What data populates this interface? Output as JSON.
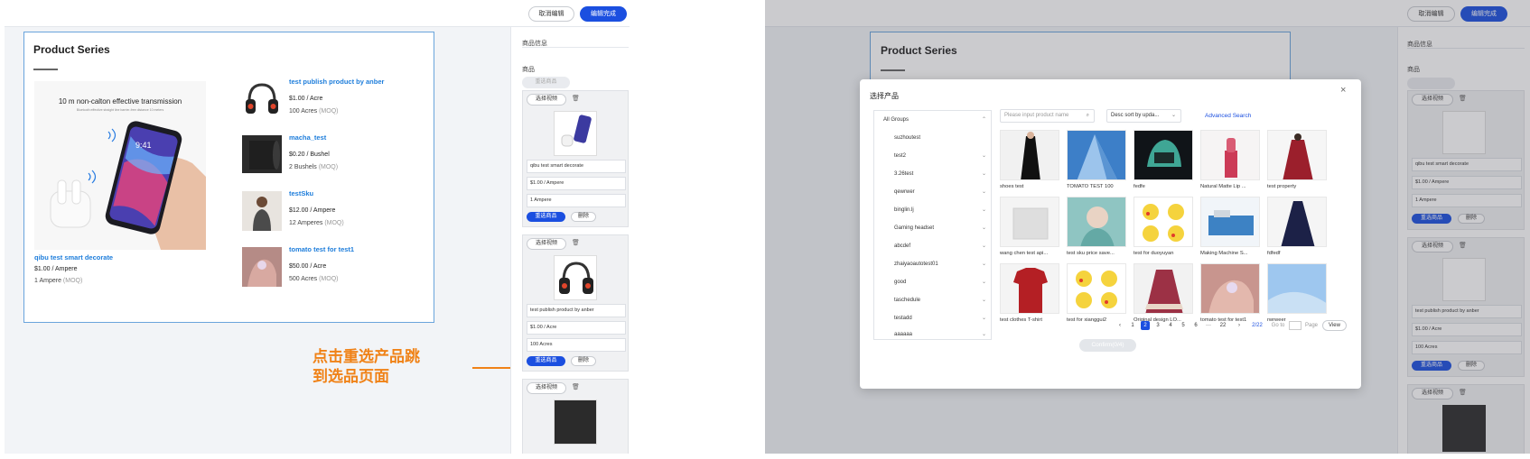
{
  "left_screen": {
    "topbar": {
      "cancel_label": "取消编辑",
      "done_label": "编辑完成"
    },
    "series": {
      "title": "Product Series",
      "banner_headline": "10 m non-calton effective transmission",
      "banner_subline": "Bluetooth effective straight line barrier-free distance 10 meters",
      "phone_time": "9:41",
      "main_product": {
        "name": "qibu test smart decorate",
        "price": "$1.00 / Ampere",
        "moq_value": "1 Ampere",
        "moq_tag": "(MOQ)"
      },
      "products": [
        {
          "name": "test publish product by anber",
          "price": "$1.00 / Acre",
          "moq_value": "100 Acres",
          "moq_tag": "(MOQ)",
          "thumb": "headset"
        },
        {
          "name": "macha_test",
          "price": "$0.20 / Bushel",
          "moq_value": "2 Bushels",
          "moq_tag": "(MOQ)",
          "thumb": "roll"
        },
        {
          "name": "testSku",
          "price": "$12.00 / Ampere",
          "moq_value": "12 Amperes",
          "moq_tag": "(MOQ)",
          "thumb": "person"
        },
        {
          "name": "tomato test for test1",
          "price": "$50.00 / Acre",
          "moq_value": "500 Acres",
          "moq_tag": "(MOQ)",
          "thumb": "hand"
        }
      ]
    },
    "panel": {
      "section_title": "商品信息",
      "product_label": "商品",
      "reselect_disabled_label": "重选商品",
      "cards": [
        {
          "video_btn": "选择视频",
          "fields": [
            "qibu test smart decorate",
            "$1.00 / Ampere",
            "1 Ampere"
          ],
          "reselect": "重选商品",
          "delete": "删除"
        },
        {
          "video_btn": "选择视频",
          "fields": [
            "test publish product by anber",
            "$1.00 / Acre",
            "100 Acres"
          ],
          "reselect": "重选商品",
          "delete": "删除"
        },
        {
          "video_btn": "选择视频"
        }
      ]
    },
    "annotation": {
      "line1": "点击重选产品跳",
      "line2": "到选品页面"
    }
  },
  "right_screen": {
    "topbar": {
      "cancel_label": "取消编辑",
      "done_label": "编辑完成"
    },
    "series_title": "Product Series",
    "panel": {
      "section_title": "商品信息",
      "product_label": "商品",
      "cards": [
        {
          "video_btn": "选择视频",
          "fields": [
            "qibu test smart decorate",
            "$1.00 / Ampere",
            "1 Ampere"
          ],
          "reselect": "重选商品",
          "delete": "删除"
        },
        {
          "video_btn": "选择视频",
          "fields": [
            "test publish product by anber",
            "$1.00 / Acre",
            "100 Acres"
          ],
          "reselect": "重选商品",
          "delete": "删除"
        },
        {
          "video_btn": "选择视频"
        }
      ]
    },
    "modal": {
      "title": "选择产品",
      "close": "×",
      "groups": [
        "All Groups",
        "suzhoutest",
        "test2",
        "3.26test",
        "qewrwer",
        "binglin.lj",
        "Gaming headset",
        "abcdef",
        "zhaiyaoautotest01",
        "good",
        "taschedule",
        "testadd",
        "aaaaaa"
      ],
      "search_placeholder": "Please input product name",
      "sort_value": "Desc sort by upda...",
      "advanced_search": "Advanced Search",
      "products": [
        {
          "name": "shoes test",
          "img": "dress-black"
        },
        {
          "name": "TOMATO TEST 100",
          "img": "building"
        },
        {
          "name": "fedfe",
          "img": "device"
        },
        {
          "name": "Natural Matte Lip ...",
          "img": "lipstick"
        },
        {
          "name": "test property",
          "img": "dress-red"
        },
        {
          "name": "wang chen test api...",
          "img": "box"
        },
        {
          "name": "test sku price save...",
          "img": "person"
        },
        {
          "name": "test for duoyuyan",
          "img": "pikachu"
        },
        {
          "name": "Making Machine S...",
          "img": "machine"
        },
        {
          "name": "fdfedf",
          "img": "gown"
        },
        {
          "name": "test clothes T-shirt",
          "img": "tshirt"
        },
        {
          "name": "test for xianggui2",
          "img": "pikachu"
        },
        {
          "name": "Original design LO...",
          "img": "lolita"
        },
        {
          "name": "tomato test for test1",
          "img": "hand"
        },
        {
          "name": "rwrweer",
          "img": "sky"
        }
      ],
      "pagination": {
        "prev": "‹",
        "pages": [
          "1",
          "2",
          "3",
          "4",
          "5",
          "6",
          "···",
          "22"
        ],
        "active_page": "2",
        "next": "›",
        "total": "2/22",
        "goto_label": "Go to",
        "page_label": "Page",
        "view_label": "View"
      },
      "confirm_label": "Confirm(0/4)"
    }
  }
}
